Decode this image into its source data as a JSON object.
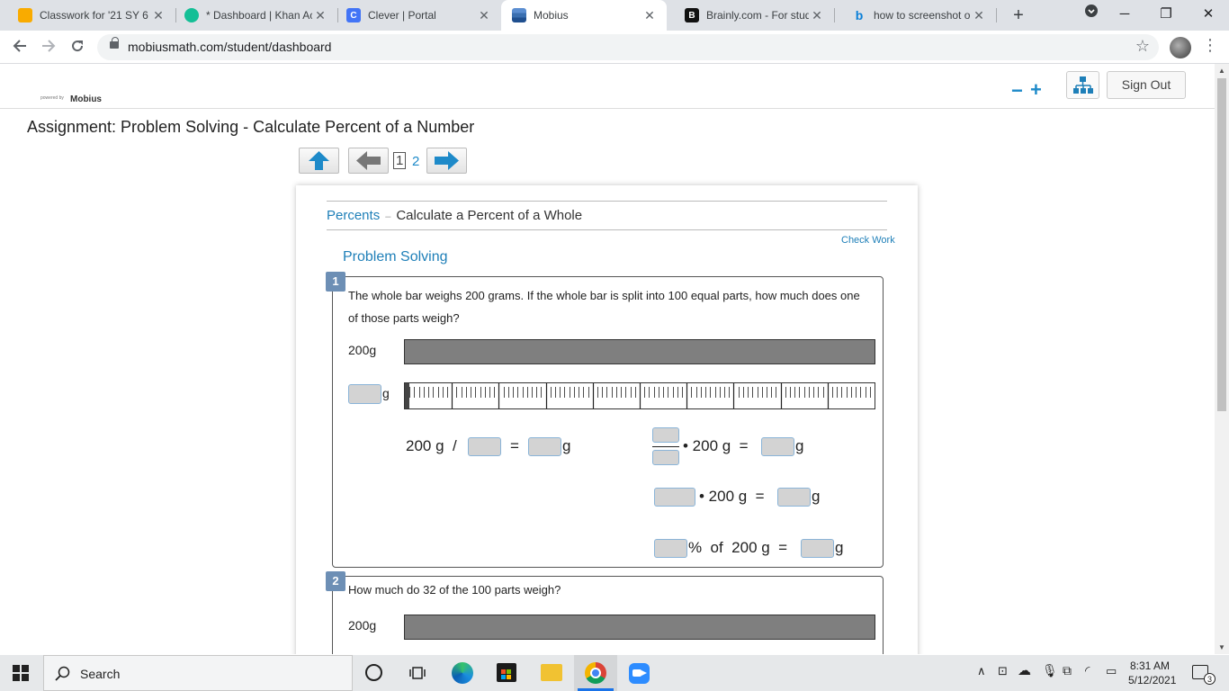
{
  "browser": {
    "tabs": [
      {
        "title": "Classwork for '21 SY 6",
        "icon": "google-classroom-icon",
        "color": "#f9ab00",
        "glyph": ""
      },
      {
        "title": "* Dashboard | Khan Ac",
        "icon": "khan-academy-icon",
        "color": "#14bf96",
        "glyph": ""
      },
      {
        "title": "Clever | Portal",
        "icon": "clever-icon",
        "color": "#4274f6",
        "glyph": "C"
      },
      {
        "title": "Mobius",
        "icon": "mobius-icon",
        "color": "#3a6fb0",
        "glyph": ""
      },
      {
        "title": "Brainly.com - For stud",
        "icon": "brainly-icon",
        "color": "#111111",
        "glyph": "B"
      },
      {
        "title": "how to screenshot on",
        "icon": "bing-icon",
        "color": "#0a7fd8",
        "glyph": "b"
      }
    ],
    "new_tab": "+",
    "url": "mobiusmath.com/student/dashboard",
    "window_controls": {
      "minimize": "─",
      "maximize": "❐",
      "close": "✕"
    }
  },
  "header": {
    "powered_by": "powered by",
    "logo": "Mobius",
    "zoom_out": "−",
    "zoom_in": "+",
    "sign_out": "Sign Out"
  },
  "assignment": {
    "title": "Assignment: Problem Solving - Calculate Percent of a Number",
    "pages": {
      "current": "1",
      "other": "2"
    }
  },
  "card": {
    "breadcrumb_topic": "Percents",
    "breadcrumb_sep": "–",
    "breadcrumb_sub": "Calculate a Percent of a Whole",
    "check_work": "Check Work",
    "section_title": "Problem Solving",
    "problem1": {
      "number": "1",
      "text": "The whole bar weighs 200 grams. If the whole bar is split into 100 equal parts, how much does one of those parts weigh?",
      "bar_label": "200g",
      "unit_g": "g",
      "eq1_a": "200 g  /",
      "eq1_eq": "=",
      "eq2_mult": "• 200 g  =",
      "eq3_mult": "• 200 g  =",
      "eq4_pct": "%  of  200 g  ="
    },
    "problem2": {
      "number": "2",
      "text": "How much do 32 of the 100 parts weigh?",
      "bar_label": "200g"
    },
    "ruler": {
      "parts": 100
    }
  },
  "taskbar": {
    "search": "Search",
    "time": "8:31 AM",
    "date": "5/12/2021",
    "notifications": "3"
  }
}
